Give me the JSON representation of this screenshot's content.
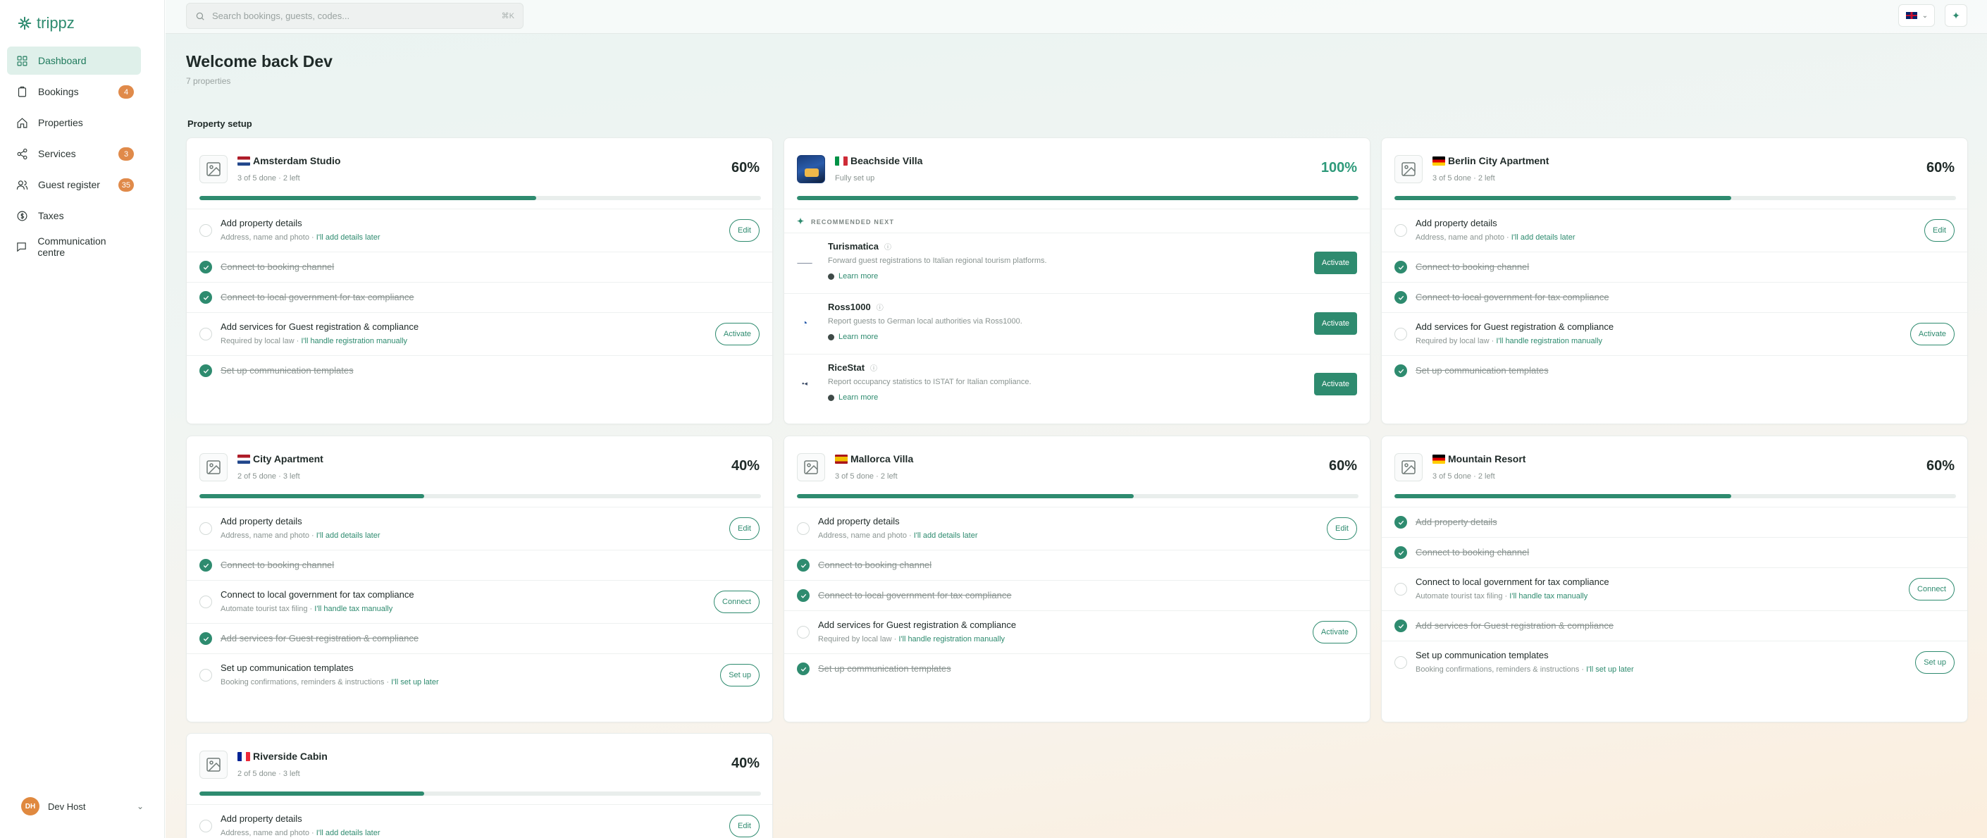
{
  "app": {
    "logo_text": "trippz"
  },
  "sidebar": {
    "items": [
      {
        "label": "Dashboard",
        "icon": "grid-icon",
        "active": true
      },
      {
        "label": "Bookings",
        "icon": "clipboard-icon",
        "badge": "4"
      },
      {
        "label": "Properties",
        "icon": "home-icon"
      },
      {
        "label": "Services",
        "icon": "share-icon",
        "badge": "3"
      },
      {
        "label": "Guest register",
        "icon": "users-icon",
        "badge": "35"
      },
      {
        "label": "Taxes",
        "icon": "coin-icon"
      },
      {
        "label": "Communication centre",
        "icon": "chat-icon"
      }
    ],
    "user": {
      "initials": "DH",
      "name": "Dev Host"
    }
  },
  "topbar": {
    "search_placeholder": "Search bookings, guests, codes...",
    "search_shortcut": "⌘K",
    "language": "EN (UK flag)"
  },
  "header": {
    "title": "Welcome back Dev",
    "subtitle": "7 properties",
    "section": "Property setup"
  },
  "colors": {
    "accent": "#2e8b6f",
    "badge": "#e08a4a"
  },
  "cards": {
    "amsterdam": {
      "name": "Amsterdam Studio",
      "status": "3 of 5 done · 2 left",
      "percent": "60%",
      "progress": 0.6,
      "tasks": {
        "t1": {
          "label": "Add property details",
          "sub": "Address, name and photo · ",
          "link": "I'll add details later",
          "button": "Edit"
        },
        "t2": {
          "label": "Connect to booking channel"
        },
        "t3": {
          "label": "Connect to local government for tax compliance"
        },
        "t4": {
          "label": "Add services for Guest registration & compliance",
          "sub": "Required by local law · ",
          "link": "I'll handle registration manually",
          "button": "Activate"
        },
        "t5": {
          "label": "Set up communication templates"
        }
      }
    },
    "beachside": {
      "name": "Beachside Villa",
      "status": "Fully set up",
      "percent": "100%",
      "progress": 1.0,
      "recommended": "RECOMMENDED NEXT",
      "recs": [
        {
          "name": "Turismatica",
          "desc": "Forward guest registrations to Italian regional tourism platforms.",
          "more": "Learn more",
          "button": "Activate"
        },
        {
          "name": "Ross1000",
          "desc": "Report guests to German local authorities via Ross1000.",
          "more": "Learn more",
          "button": "Activate"
        },
        {
          "name": "RiceStat",
          "desc": "Report occupancy statistics to ISTAT for Italian compliance.",
          "more": "Learn more",
          "button": "Activate"
        }
      ]
    },
    "berlin": {
      "name": "Berlin City Apartment",
      "status": "3 of 5 done · 2 left",
      "percent": "60%",
      "progress": 0.6,
      "tasks": {
        "t1": {
          "label": "Add property details",
          "sub": "Address, name and photo · ",
          "link": "I'll add details later",
          "button": "Edit"
        },
        "t2": {
          "label": "Connect to booking channel"
        },
        "t3": {
          "label": "Connect to local government for tax compliance"
        },
        "t4": {
          "label": "Add services for Guest registration & compliance",
          "sub": "Required by local law · ",
          "link": "I'll handle registration manually",
          "button": "Activate"
        },
        "t5": {
          "label": "Set up communication templates"
        }
      }
    },
    "city": {
      "name": "City Apartment",
      "status": "2 of 5 done · 3 left",
      "percent": "40%",
      "progress": 0.4,
      "tasks": {
        "t1": {
          "label": "Add property details",
          "sub": "Address, name and photo · ",
          "link": "I'll add details later",
          "button": "Edit"
        },
        "t2": {
          "label": "Connect to booking channel"
        },
        "t3": {
          "label": "Connect to local government for tax compliance",
          "sub": "Automate tourist tax filing · ",
          "link": "I'll handle tax manually",
          "button": "Connect"
        },
        "t4": {
          "label": "Add services for Guest registration & compliance"
        },
        "t5": {
          "label": "Set up communication templates",
          "sub": "Booking confirmations, reminders & instructions · ",
          "link": "I'll set up later",
          "button": "Set up"
        }
      }
    },
    "mallorca": {
      "name": "Mallorca Villa",
      "status": "3 of 5 done · 2 left",
      "percent": "60%",
      "progress": 0.6,
      "tasks": {
        "t1": {
          "label": "Add property details",
          "sub": "Address, name and photo · ",
          "link": "I'll add details later",
          "button": "Edit"
        },
        "t2": {
          "label": "Connect to booking channel"
        },
        "t3": {
          "label": "Connect to local government for tax compliance"
        },
        "t4": {
          "label": "Add services for Guest registration & compliance",
          "sub": "Required by local law · ",
          "link": "I'll handle registration manually",
          "button": "Activate"
        },
        "t5": {
          "label": "Set up communication templates"
        }
      }
    },
    "mountain": {
      "name": "Mountain Resort",
      "status": "3 of 5 done · 2 left",
      "percent": "60%",
      "progress": 0.6,
      "tasks": {
        "t1": {
          "label": "Add property details"
        },
        "t2": {
          "label": "Connect to booking channel"
        },
        "t3": {
          "label": "Connect to local government for tax compliance",
          "sub": "Automate tourist tax filing · ",
          "link": "I'll handle tax manually",
          "button": "Connect"
        },
        "t4": {
          "label": "Add services for Guest registration & compliance"
        },
        "t5": {
          "label": "Set up communication templates",
          "sub": "Booking confirmations, reminders & instructions · ",
          "link": "I'll set up later",
          "button": "Set up"
        }
      }
    },
    "riverside": {
      "name": "Riverside Cabin",
      "status": "2 of 5 done · 3 left",
      "percent": "40%",
      "progress": 0.4,
      "tasks": {
        "t1": {
          "label": "Add property details",
          "sub": "Address, name and photo · ",
          "link": "I'll add details later",
          "button": "Edit"
        }
      }
    }
  }
}
